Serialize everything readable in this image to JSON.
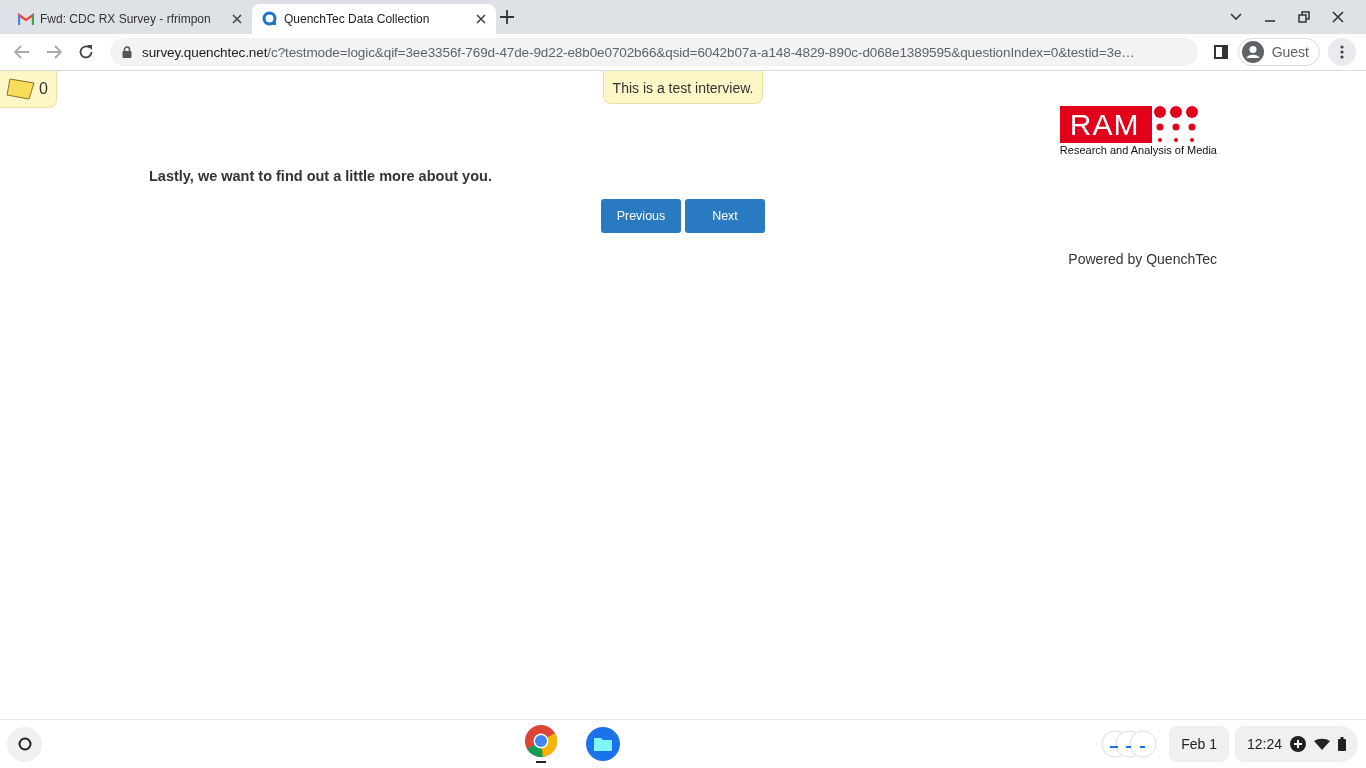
{
  "tabs": [
    {
      "title": "Fwd: CDC RX Survey - rfrimpon",
      "kind": "mail",
      "selected": false
    },
    {
      "title": "QuenchTec Data Collection",
      "kind": "survey",
      "selected": true
    }
  ],
  "address_bar": {
    "host": "survey.quenchtec.net",
    "path": "/c?testmode=logic&qif=3ee3356f-769d-47de-9d22-e8b0e0702b66&qsid=6042b07a-a148-4829-890c-d068e1389595&questionIndex=0&testid=3e…"
  },
  "profile": {
    "label": "Guest"
  },
  "notes": {
    "count": "0"
  },
  "test_banner": "This is a test interview.",
  "logo": {
    "mark": "RAM",
    "caption": "Research and Analysis of Media"
  },
  "question": "Lastly, we want to find out a little more about you.",
  "buttons": [
    "Previous",
    "Next"
  ],
  "footer": "Powered by QuenchTec",
  "shelf": {
    "date": "Feb 1",
    "time": "12:24"
  }
}
